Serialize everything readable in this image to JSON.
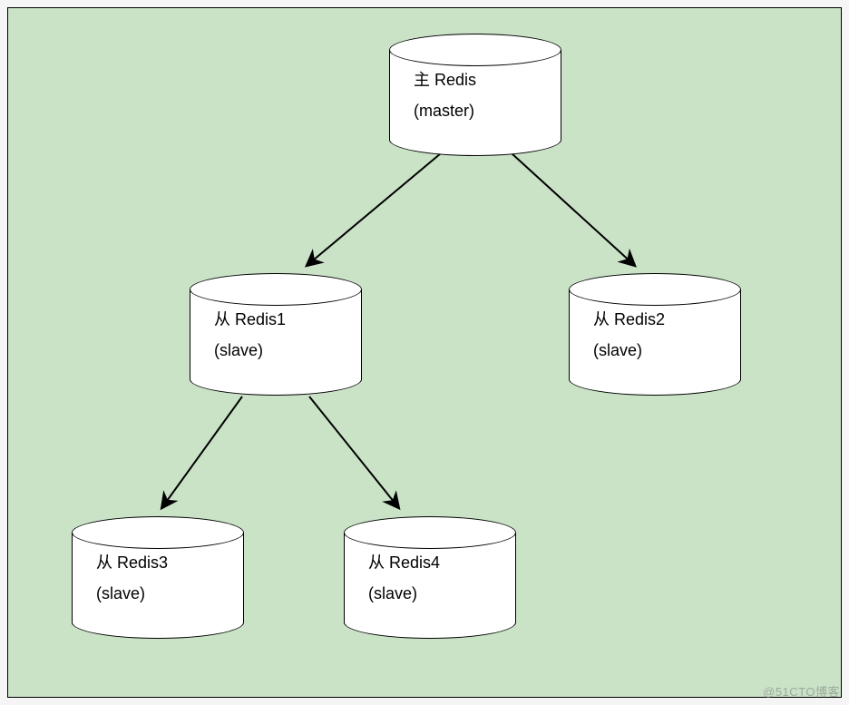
{
  "diagram": {
    "nodes": {
      "master": {
        "label1": "主 Redis",
        "label2": "(master)"
      },
      "slave1": {
        "label1": "从 Redis1",
        "label2": "(slave)"
      },
      "slave2": {
        "label1": "从 Redis2",
        "label2": "(slave)"
      },
      "slave3": {
        "label1": "从 Redis3",
        "label2": "(slave)"
      },
      "slave4": {
        "label1": "从 Redis4",
        "label2": "(slave)"
      }
    },
    "edges": [
      {
        "from": "master",
        "to": "slave1"
      },
      {
        "from": "master",
        "to": "slave2"
      },
      {
        "from": "slave1",
        "to": "slave3"
      },
      {
        "from": "slave1",
        "to": "slave4"
      }
    ]
  },
  "watermark": "@51CTO博客"
}
